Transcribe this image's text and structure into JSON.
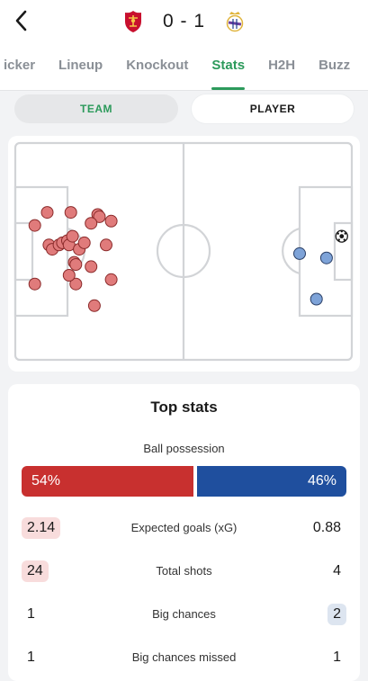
{
  "header": {
    "score": "0 - 1",
    "home_crest": "liverpool-crest-icon",
    "away_crest": "real-madrid-crest-icon"
  },
  "tabs": [
    {
      "label": "Ticker",
      "visible_text": "icker"
    },
    {
      "label": "Lineup"
    },
    {
      "label": "Knockout"
    },
    {
      "label": "Stats",
      "active": true
    },
    {
      "label": "H2H"
    },
    {
      "label": "Buzz"
    }
  ],
  "toggle": {
    "team_label": "TEAM",
    "player_label": "PLAYER",
    "selected": "TEAM"
  },
  "shot_map": {
    "home_color": "#e07b7b",
    "away_color": "#7ea3d8",
    "home_shots": [
      [
        0.058,
        0.38
      ],
      [
        0.1,
        0.47
      ],
      [
        0.11,
        0.49
      ],
      [
        0.13,
        0.47
      ],
      [
        0.14,
        0.46
      ],
      [
        0.155,
        0.45
      ],
      [
        0.16,
        0.47
      ],
      [
        0.17,
        0.43
      ],
      [
        0.175,
        0.55
      ],
      [
        0.18,
        0.56
      ],
      [
        0.19,
        0.49
      ],
      [
        0.205,
        0.46
      ],
      [
        0.165,
        0.32
      ],
      [
        0.095,
        0.32
      ],
      [
        0.245,
        0.33
      ],
      [
        0.25,
        0.34
      ],
      [
        0.225,
        0.37
      ],
      [
        0.285,
        0.36
      ],
      [
        0.27,
        0.47
      ],
      [
        0.225,
        0.57
      ],
      [
        0.285,
        0.63
      ],
      [
        0.058,
        0.65
      ],
      [
        0.18,
        0.65
      ],
      [
        0.16,
        0.61
      ],
      [
        0.235,
        0.75
      ]
    ],
    "away_shots": [
      [
        0.845,
        0.51
      ],
      [
        0.925,
        0.53
      ],
      [
        0.895,
        0.72
      ]
    ],
    "away_goals": [
      [
        0.97,
        0.43
      ]
    ]
  },
  "stats": {
    "title": "Top stats",
    "possession": {
      "label": "Ball possession",
      "home": "54%",
      "away": "46%",
      "home_share": 0.54,
      "home_color": "#c8302f",
      "away_color": "#1f4f9e"
    },
    "rows": [
      {
        "name": "Expected goals (xG)",
        "home": "2.14",
        "away": "0.88",
        "leader": "home"
      },
      {
        "name": "Total shots",
        "home": "24",
        "away": "4",
        "leader": "home"
      },
      {
        "name": "Big chances",
        "home": "1",
        "away": "2",
        "leader": "away"
      },
      {
        "name": "Big chances missed",
        "home": "1",
        "away": "1",
        "leader": "none"
      }
    ]
  }
}
